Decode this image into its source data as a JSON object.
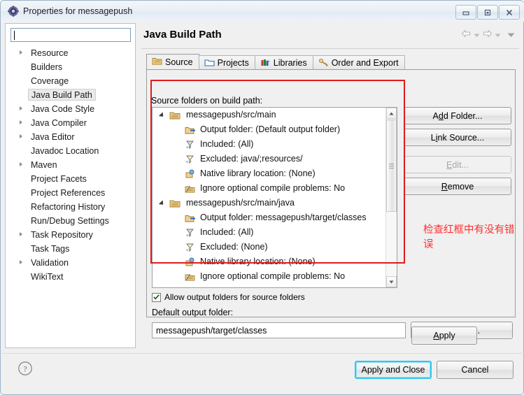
{
  "window": {
    "title": "Properties for messagepush",
    "icon": "eclipse-properties-icon",
    "minimize_label": "Minimize",
    "maximize_label": "Maximize",
    "close_label": "Close"
  },
  "sidebar": {
    "filter_value": "",
    "filter_placeholder": "",
    "items": [
      {
        "label": "Resource",
        "expandable": true,
        "selected": false
      },
      {
        "label": "Builders",
        "expandable": false,
        "selected": false
      },
      {
        "label": "Coverage",
        "expandable": false,
        "selected": false
      },
      {
        "label": "Java Build Path",
        "expandable": false,
        "selected": true
      },
      {
        "label": "Java Code Style",
        "expandable": true,
        "selected": false
      },
      {
        "label": "Java Compiler",
        "expandable": true,
        "selected": false
      },
      {
        "label": "Java Editor",
        "expandable": true,
        "selected": false
      },
      {
        "label": "Javadoc Location",
        "expandable": false,
        "selected": false
      },
      {
        "label": "Maven",
        "expandable": true,
        "selected": false
      },
      {
        "label": "Project Facets",
        "expandable": false,
        "selected": false
      },
      {
        "label": "Project References",
        "expandable": false,
        "selected": false
      },
      {
        "label": "Refactoring History",
        "expandable": false,
        "selected": false
      },
      {
        "label": "Run/Debug Settings",
        "expandable": false,
        "selected": false
      },
      {
        "label": "Task Repository",
        "expandable": true,
        "selected": false
      },
      {
        "label": "Task Tags",
        "expandable": false,
        "selected": false
      },
      {
        "label": "Validation",
        "expandable": true,
        "selected": false
      },
      {
        "label": "WikiText",
        "expandable": false,
        "selected": false
      }
    ]
  },
  "page": {
    "title": "Java Build Path",
    "nav": {
      "back_icon": "back-arrow-icon",
      "back_menu_icon": "chevron-down-icon",
      "forward_icon": "forward-arrow-icon",
      "forward_menu_icon": "chevron-down-icon",
      "view_menu_icon": "chevron-down-icon"
    }
  },
  "tabs": [
    {
      "label": "Source",
      "icon": "source-folder-icon",
      "active": true
    },
    {
      "label": "Projects",
      "icon": "project-icon",
      "active": false
    },
    {
      "label": "Libraries",
      "icon": "library-icon",
      "active": false
    },
    {
      "label": "Order and Export",
      "icon": "order-export-icon",
      "active": false
    }
  ],
  "source_tab": {
    "tree_label": "Source folders on build path:",
    "rows": [
      {
        "level": "root",
        "icon": "source-folder-icon",
        "text": "messagepush/src/main"
      },
      {
        "level": "child",
        "icon": "output-folder-icon",
        "text": "Output folder: (Default output folder)"
      },
      {
        "level": "child",
        "icon": "included-filter-icon",
        "text": "Included: (All)"
      },
      {
        "level": "child",
        "icon": "excluded-filter-icon",
        "text": "Excluded: java/;resources/"
      },
      {
        "level": "child",
        "icon": "native-library-icon",
        "text": "Native library location: (None)"
      },
      {
        "level": "child",
        "icon": "ignore-problems-icon",
        "text": "Ignore optional compile problems: No"
      },
      {
        "level": "root",
        "icon": "source-folder-icon",
        "text": "messagepush/src/main/java"
      },
      {
        "level": "child",
        "icon": "output-folder-icon",
        "text": "Output folder: messagepush/target/classes"
      },
      {
        "level": "child",
        "icon": "included-filter-icon",
        "text": "Included: (All)"
      },
      {
        "level": "child",
        "icon": "excluded-filter-icon",
        "text": "Excluded: (None)"
      },
      {
        "level": "child",
        "icon": "native-library-icon",
        "text": "Native library location: (None)"
      },
      {
        "level": "child",
        "icon": "ignore-problems-icon",
        "text": "Ignore optional compile problems: No"
      }
    ],
    "buttons": [
      {
        "label": "Add Folder...",
        "accel": "d",
        "disabled": false
      },
      {
        "label": "Link Source...",
        "accel": "i",
        "disabled": false
      },
      {
        "label": "Edit...",
        "accel": "E",
        "disabled": true
      },
      {
        "label": "Remove",
        "accel": "R",
        "disabled": false
      }
    ],
    "allow_output_label": "Allow output folders for source folders",
    "allow_output_checked": true,
    "default_output_label": "Default output folder:",
    "default_output_value": "messagepush/target/classes",
    "browse_label": "Browse...",
    "apply_label": "Apply"
  },
  "annotation": {
    "text": "检查红框中有没有错误",
    "color": "#ff2f2f",
    "box_color": "#e01b1b"
  },
  "footer": {
    "help_icon": "help-question-icon",
    "apply_and_close_label": "Apply and Close",
    "cancel_label": "Cancel",
    "focus_color": "#33c6ef"
  }
}
